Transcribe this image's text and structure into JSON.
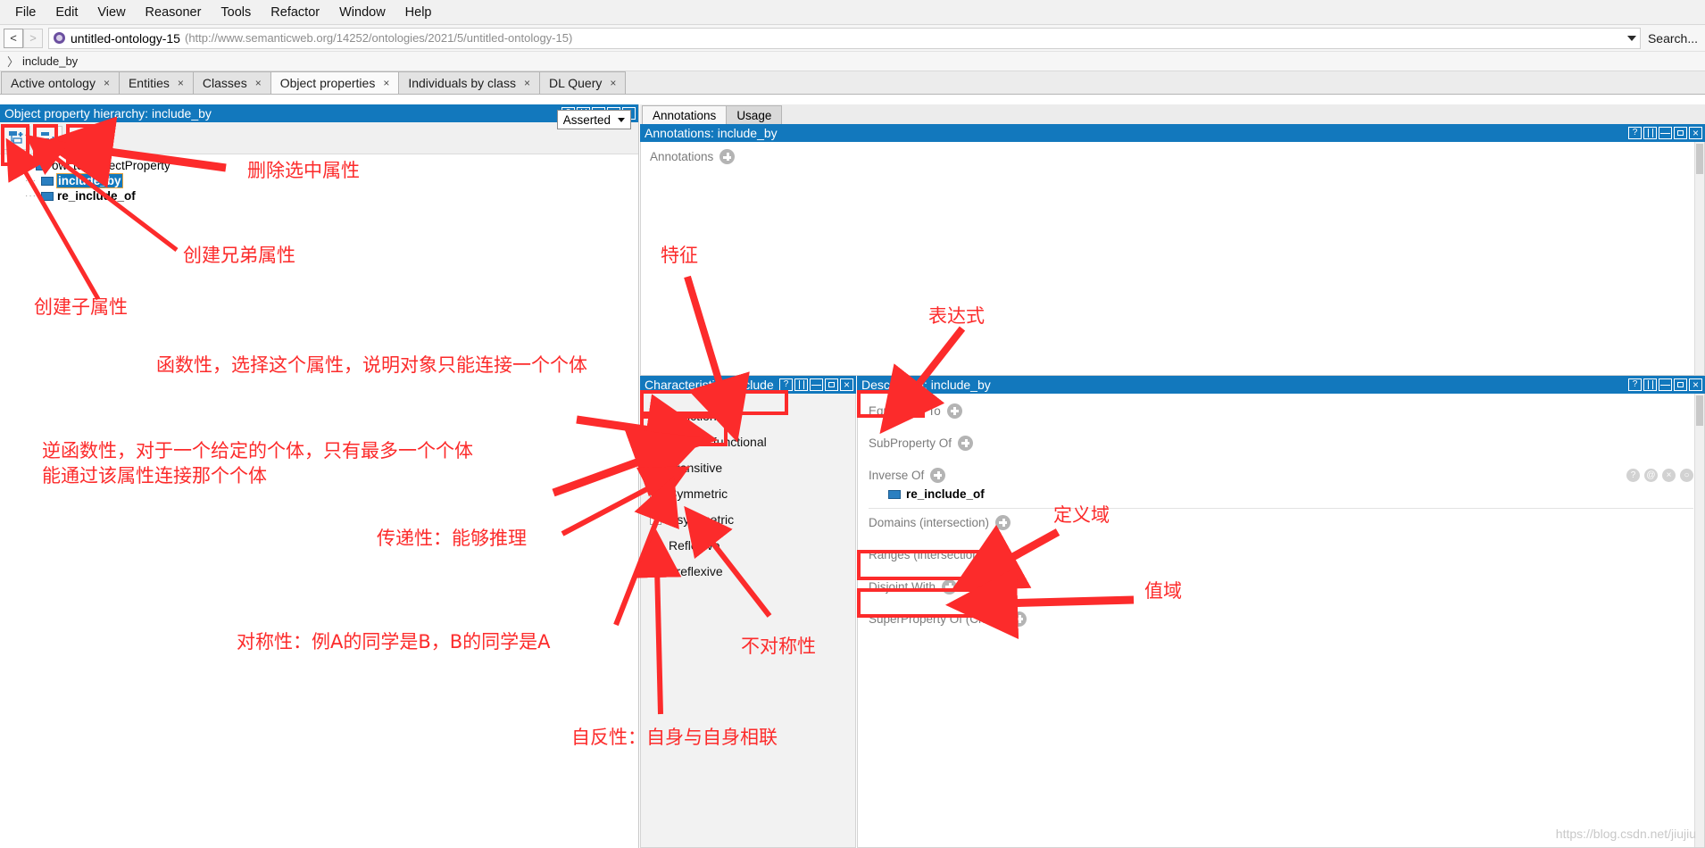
{
  "menubar": {
    "items": [
      "File",
      "Edit",
      "View",
      "Reasoner",
      "Tools",
      "Refactor",
      "Window",
      "Help"
    ]
  },
  "iribar": {
    "back_label": "<",
    "forward_label": ">",
    "ontology_name": "untitled-ontology-15",
    "ontology_url": "(http://www.semanticweb.org/14252/ontologies/2021/5/untitled-ontology-15)",
    "search_label": "Search..."
  },
  "breadcrumb": {
    "chevron": "〉",
    "label": "include_by"
  },
  "tabs": [
    {
      "label": "Active ontology",
      "close": "×",
      "active": false
    },
    {
      "label": "Entities",
      "close": "×",
      "active": false
    },
    {
      "label": "Classes",
      "close": "×",
      "active": false
    },
    {
      "label": "Object properties",
      "close": "×",
      "active": true
    },
    {
      "label": "Individuals by class",
      "close": "×",
      "active": false
    },
    {
      "label": "DL Query",
      "close": "×",
      "active": false
    }
  ],
  "hierarchy": {
    "title": "Object property hierarchy: include_by",
    "toolbar": {
      "add_subproperty": "add-subproperty",
      "add_sibling_property": "add-sibling-property",
      "delete_property": "delete-property"
    },
    "reasoner_selector": "Asserted",
    "tree": [
      {
        "label": "owl:topObjectProperty",
        "depth": 0,
        "selected": false,
        "expander": "▼"
      },
      {
        "label": "include_by",
        "depth": 1,
        "selected": true,
        "expander": ""
      },
      {
        "label": "re_include_of",
        "depth": 1,
        "selected": false,
        "expander": ""
      }
    ]
  },
  "annotations_panel": {
    "tabs": [
      {
        "label": "Annotations",
        "active": true
      },
      {
        "label": "Usage",
        "active": false
      }
    ],
    "title": "Annotations: include_by",
    "row_label": "Annotations"
  },
  "characteristics_panel": {
    "title": "Characteristics: include_",
    "items": [
      {
        "label": "Functional",
        "checked": false
      },
      {
        "label": "Inverse functional",
        "checked": false
      },
      {
        "label": "Transitive",
        "checked": false
      },
      {
        "label": "Symmetric",
        "checked": false
      },
      {
        "label": "Asymmetric",
        "checked": false
      },
      {
        "label": "Reflexive",
        "checked": false
      },
      {
        "label": "Irreflexive",
        "checked": false
      }
    ]
  },
  "description_panel": {
    "title": "Description: include_by",
    "rows": [
      {
        "label": "Equivalent To",
        "value": null
      },
      {
        "label": "SubProperty Of",
        "value": null
      },
      {
        "label": "Inverse Of",
        "value": "re_include_of"
      },
      {
        "label": "Domains (intersection)",
        "value": null
      },
      {
        "label": "Ranges (intersection)",
        "value": null
      },
      {
        "label": "Disjoint With",
        "value": null
      },
      {
        "label": "SuperProperty Of (Chain)",
        "value": null
      }
    ],
    "row_icons": [
      "?",
      "@",
      "×",
      "○"
    ]
  },
  "window_buttons": {
    "help": "?",
    "split": "split",
    "hsplit": "hsplit",
    "maximize": "maximize",
    "close": "×"
  },
  "annotations_overlay": {
    "colors": {
      "marker": "#fc2b2b"
    },
    "notes": [
      {
        "id": "delete-selected-property",
        "text": "删除选中属性"
      },
      {
        "id": "create-sibling-property",
        "text": "创建兄弟属性"
      },
      {
        "id": "create-sub-property",
        "text": "创建子属性"
      },
      {
        "id": "functional-note",
        "text": "函数性，选择这个属性，说明对象只能连接一个个体"
      },
      {
        "id": "inverse-functional-note",
        "text": "逆函数性，对于一个给定的个体，只有最多一个个体\n能通过该属性连接那个个体"
      },
      {
        "id": "transitive-note",
        "text": "传递性：能够推理"
      },
      {
        "id": "symmetric-note",
        "text": "对称性：例A的同学是B，B的同学是A"
      },
      {
        "id": "asymmetric-note",
        "text": "不对称性"
      },
      {
        "id": "reflexive-note",
        "text": "自反性：自身与自身相联"
      },
      {
        "id": "characteristics-note",
        "text": "特征"
      },
      {
        "id": "expression-note",
        "text": "表达式"
      },
      {
        "id": "domain-note",
        "text": "定义域"
      },
      {
        "id": "range-note",
        "text": "值域"
      }
    ]
  },
  "watermark": "https://blog.csdn.net/jiujiu"
}
